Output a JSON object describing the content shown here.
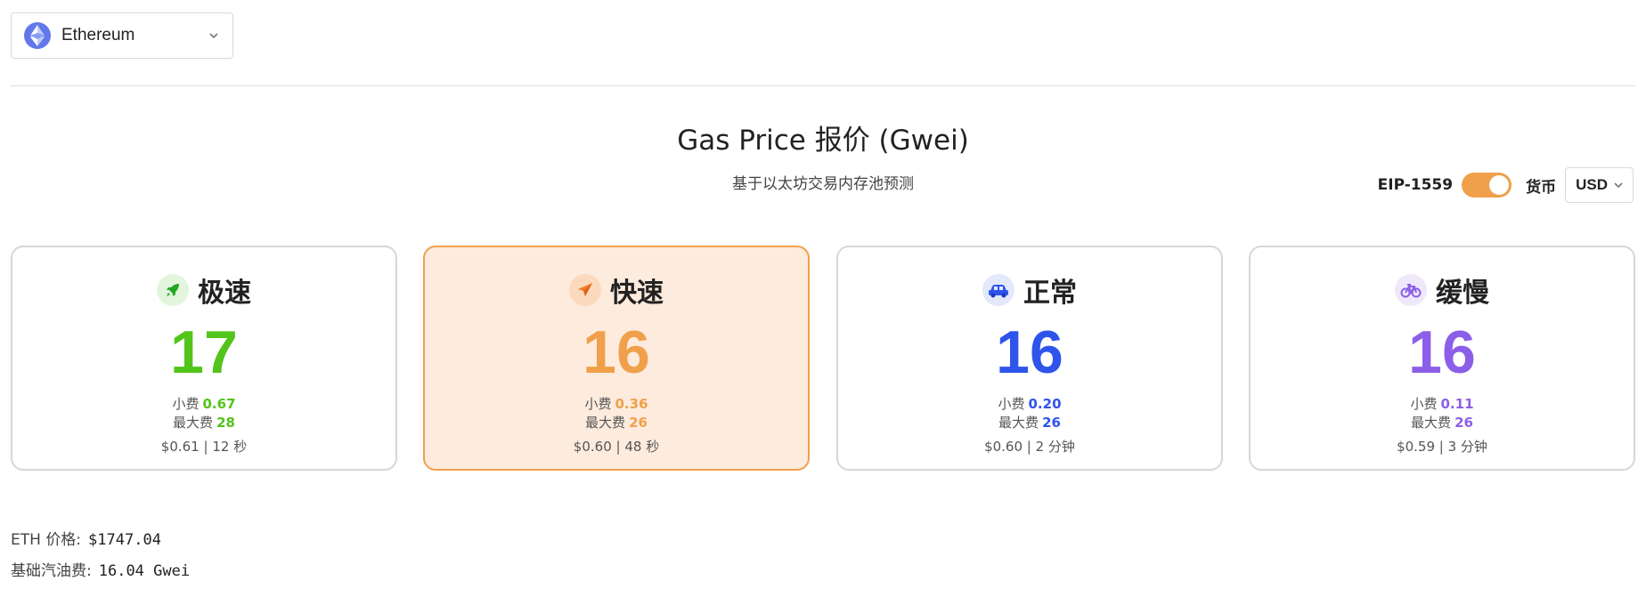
{
  "network": {
    "label": "Ethereum",
    "icon": "ethereum-logo-icon",
    "brand_color": "#6278ea"
  },
  "header": {
    "title": "Gas Price 报价 (Gwei)",
    "subtitle": "基于以太坊交易内存池预测"
  },
  "controls": {
    "eip_label": "EIP-1559",
    "eip_enabled": true,
    "currency_label": "货币",
    "currency_value": "USD"
  },
  "cards": [
    {
      "name": "极速",
      "icon": "rocket-icon",
      "color": "#52c41a",
      "icon_bg": "#e3f5dc",
      "price": "17",
      "tip_label": "小费",
      "tip": "0.67",
      "max_label": "最大费",
      "max": "28",
      "cost": "$0.61",
      "time": "12 秒",
      "selected": false
    },
    {
      "name": "快速",
      "icon": "plane-icon",
      "color": "#f0a04b",
      "icon_bg": "#fbd9bd",
      "price": "16",
      "tip_label": "小费",
      "tip": "0.36",
      "max_label": "最大费",
      "max": "26",
      "cost": "$0.60",
      "time": "48 秒",
      "selected": true
    },
    {
      "name": "正常",
      "icon": "car-icon",
      "color": "#2f54eb",
      "icon_bg": "#e3e9fb",
      "price": "16",
      "tip_label": "小费",
      "tip": "0.20",
      "max_label": "最大费",
      "max": "26",
      "cost": "$0.60",
      "time": "2 分钟",
      "selected": false
    },
    {
      "name": "缓慢",
      "icon": "bicycle-icon",
      "color": "#8c5fe8",
      "icon_bg": "#efe8fb",
      "price": "16",
      "tip_label": "小费",
      "tip": "0.11",
      "max_label": "最大费",
      "max": "26",
      "cost": "$0.59",
      "time": "3 分钟",
      "selected": false
    }
  ],
  "info": {
    "eth_price_label": "ETH 价格:",
    "eth_price": "$1747.04",
    "base_fee_label": "基础汽油费:",
    "base_fee": "16.04 Gwei"
  }
}
